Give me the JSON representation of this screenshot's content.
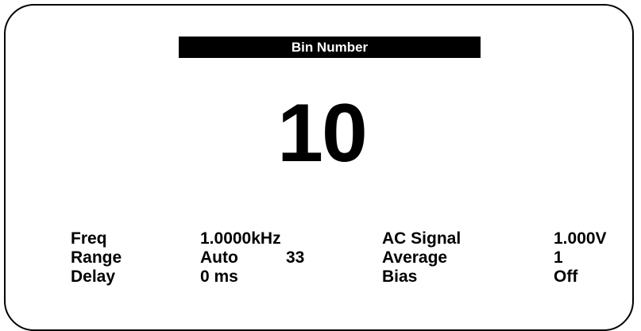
{
  "title": "Bin Number",
  "bin_value": "10",
  "params": {
    "freq": {
      "label": "Freq",
      "value": "1.0000kHz"
    },
    "range": {
      "label": "Range",
      "value": "Auto",
      "extra": "33"
    },
    "delay": {
      "label": "Delay",
      "value": "0 ms"
    },
    "ac_signal": {
      "label": "AC Signal",
      "value": "1.000V"
    },
    "average": {
      "label": "Average",
      "value": "1"
    },
    "bias": {
      "label": "Bias",
      "value": "Off"
    }
  }
}
